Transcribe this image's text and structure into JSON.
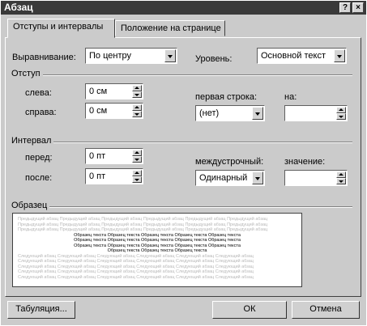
{
  "window": {
    "title": "Абзац",
    "help_label": "?",
    "close_label": "×"
  },
  "tabs": [
    {
      "label": "Отступы и интервалы"
    },
    {
      "label": "Положение на странице"
    }
  ],
  "alignment": {
    "label": "Выравнивание:",
    "value": "По центру"
  },
  "level": {
    "label": "Уровень:",
    "value": "Основной текст"
  },
  "indent": {
    "title": "Отступ",
    "left_label": "слева:",
    "left_value": "0 см",
    "right_label": "справа:",
    "right_value": "0 см",
    "first_line_label": "первая строка:",
    "first_line_value": "(нет)",
    "by_label": "на:",
    "by_value": ""
  },
  "spacing": {
    "title": "Интервал",
    "before_label": "перед:",
    "before_value": "0 пт",
    "after_label": "после:",
    "after_value": "0 пт",
    "line_label": "междустрочный:",
    "line_value": "Одинарный",
    "value_label": "значение:",
    "value_value": ""
  },
  "sample": {
    "title": "Образец",
    "prev_text": "Предыдущий абзац Предыдущий абзац Предыдущий абзац Предыдущий абзац Предыдущий абзац Предыдущий абзац",
    "sample_text": "Образец текста Образец текста Образец текста Образец текста Образец текста",
    "sample_last": "Образец текста Образец текста Образец текста",
    "next_text": "Следующий абзац Следующий абзац Следующий абзац Следующий абзац Следующий абзац Следующий абзац"
  },
  "buttons": {
    "tabs": "Табуляция...",
    "ok": "ОК",
    "cancel": "Отмена"
  }
}
